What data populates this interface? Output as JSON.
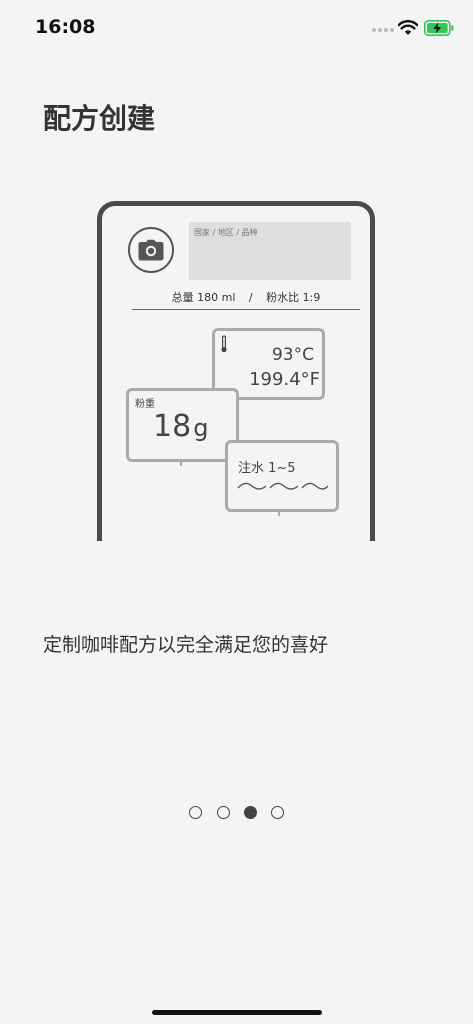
{
  "status_bar": {
    "time": "16:08",
    "signal_icon": "signal-bars-icon",
    "wifi_icon": "wifi-icon",
    "battery_icon": "battery-charging-icon",
    "battery_color": "#34c759"
  },
  "page": {
    "title": "配方创建",
    "description": "定制咖啡配方以完全满足您的喜好"
  },
  "illustration": {
    "camera_icon": "camera-icon",
    "origin_placeholder": "国家 / 地区 / 品种",
    "summary_total": "总量 180 ml",
    "summary_separator": "/",
    "summary_ratio": "粉水比 1:9",
    "temperature": {
      "icon": "thermometer-icon",
      "celsius": "93°C",
      "fahrenheit": "199.4°F"
    },
    "dose": {
      "label": "粉重",
      "value": "18",
      "unit": "g"
    },
    "water": {
      "label": "注水 1~5",
      "icon": "wave-icon"
    }
  },
  "pagination": {
    "total": 4,
    "active_index": 2
  },
  "colors": {
    "background": "#f4f4f4",
    "frame": "#4a4a4a",
    "card_border": "#aaaaaa",
    "text": "#333333"
  }
}
